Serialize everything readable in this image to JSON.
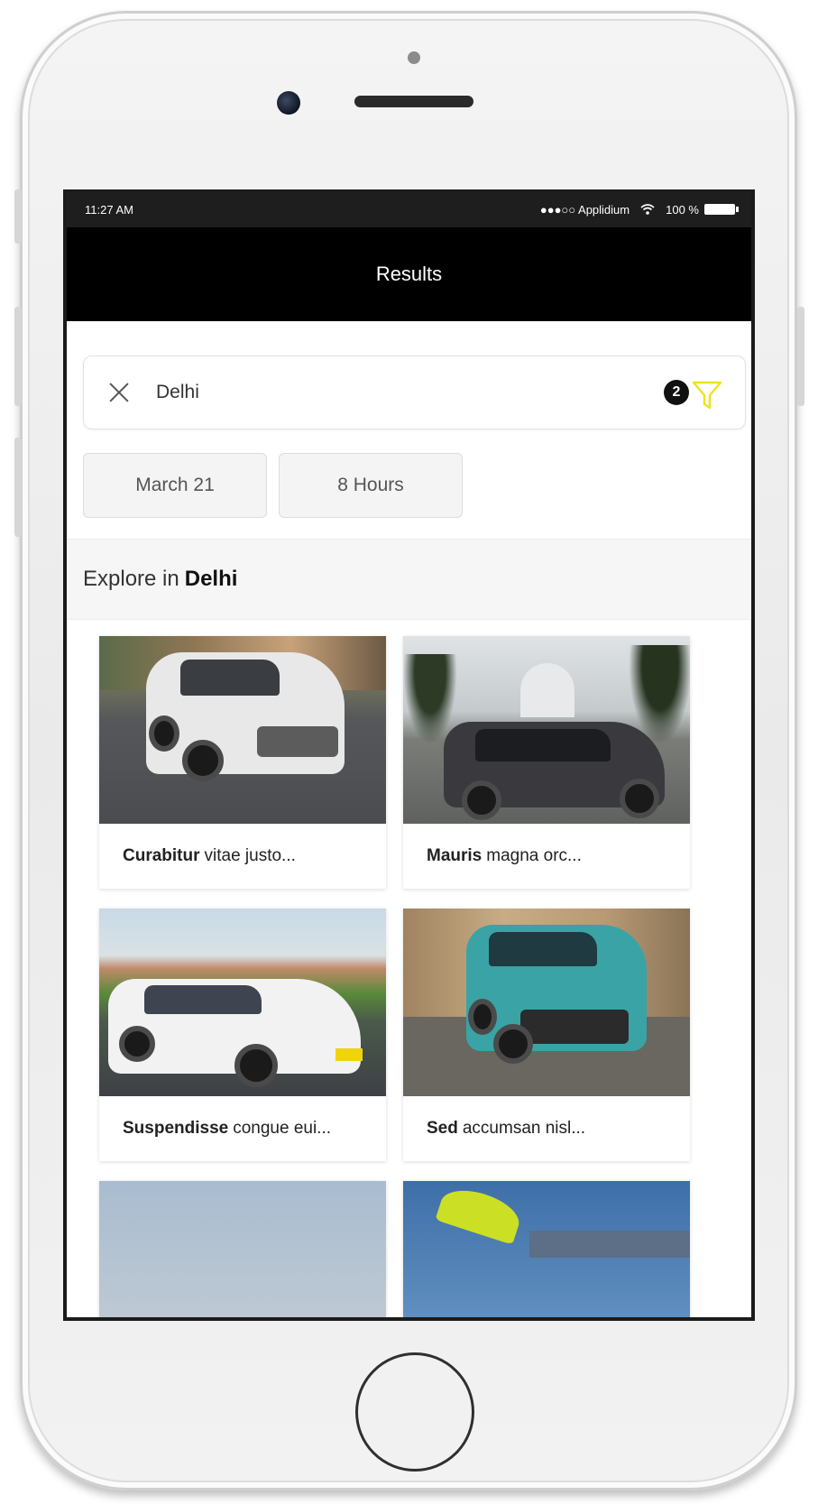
{
  "status_bar": {
    "time": "11:27 AM",
    "carrier": "●●●○○ Applidium",
    "wifi_icon": "wifi-icon",
    "battery": "100 %"
  },
  "nav": {
    "title": "Results"
  },
  "search": {
    "value": "Delhi",
    "filter_count": "2",
    "clear_icon": "close-icon",
    "filter_icon": "filter-icon",
    "accent_color": "#f2e21a"
  },
  "chips": {
    "date": "March 21",
    "duration": "8 Hours"
  },
  "explore": {
    "prefix": "Explore in",
    "city": "Delhi"
  },
  "cards": [
    {
      "bold": "Curabitur",
      "rest": "vitae justo..."
    },
    {
      "bold": "Mauris",
      "rest": "magna orc..."
    },
    {
      "bold": "Suspendisse",
      "rest": "congue eui..."
    },
    {
      "bold": "Sed",
      "rest": "accumsan nisl..."
    }
  ]
}
